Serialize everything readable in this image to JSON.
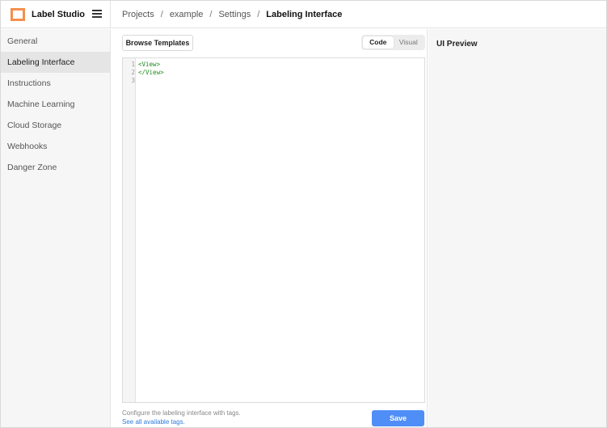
{
  "app": {
    "name": "Label Studio",
    "accent": "#f58f4d"
  },
  "breadcrumb": {
    "items": [
      "Projects",
      "example",
      "Settings"
    ],
    "current": "Labeling Interface",
    "separator": "/"
  },
  "sidebar": {
    "items": [
      {
        "label": "General",
        "active": false
      },
      {
        "label": "Labeling Interface",
        "active": true
      },
      {
        "label": "Instructions",
        "active": false
      },
      {
        "label": "Machine Learning",
        "active": false
      },
      {
        "label": "Cloud Storage",
        "active": false
      },
      {
        "label": "Webhooks",
        "active": false
      },
      {
        "label": "Danger Zone",
        "active": false
      }
    ]
  },
  "toolbar": {
    "browse_label": "Browse Templates",
    "mode_code": "Code",
    "mode_visual": "Visual",
    "selected_mode": "Code"
  },
  "editor": {
    "lines": [
      {
        "number": "1",
        "text": "<View>"
      },
      {
        "number": "2",
        "text": "</View>"
      },
      {
        "number": "3",
        "text": ""
      }
    ],
    "code_color": "#228b22"
  },
  "footer": {
    "hint": "Configure the labeling interface with tags.",
    "link": "See all available tags.",
    "save_label": "Save",
    "save_color": "#4f8ef7"
  },
  "preview": {
    "title": "UI Preview"
  }
}
